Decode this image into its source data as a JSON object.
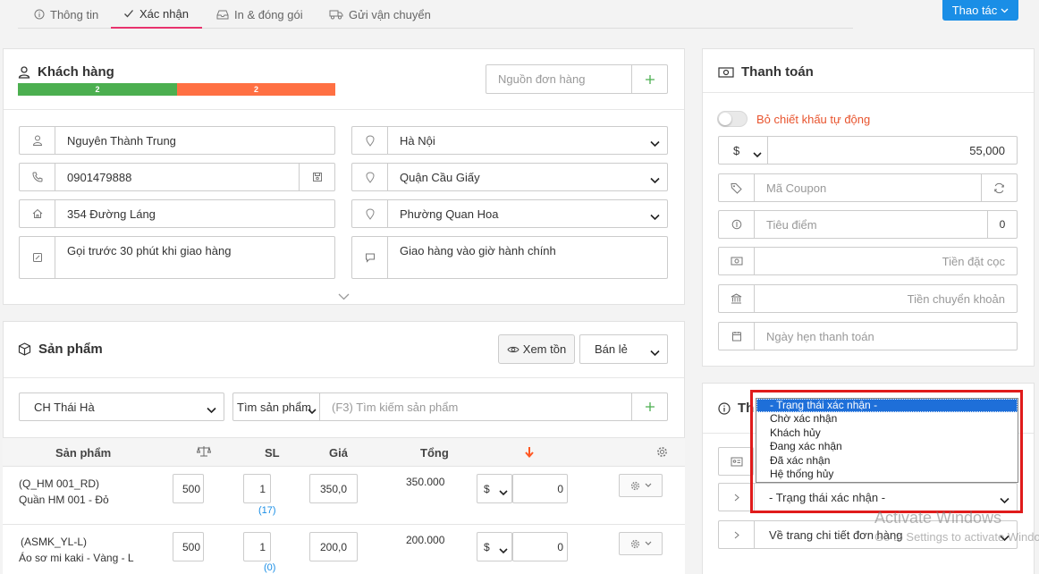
{
  "tabs": [
    {
      "label": "Thông tin",
      "icon": "info-circle-icon"
    },
    {
      "label": "Xác nhận",
      "icon": "check-icon"
    },
    {
      "label": "In & đóng gói",
      "icon": "inbox-icon"
    },
    {
      "label": "Gửi vận chuyển",
      "icon": "truck-icon"
    }
  ],
  "actions_button": "Thao tác",
  "customer": {
    "title": "Khách hàng",
    "progress_green": "2",
    "progress_orange": "2",
    "source_placeholder": "Nguồn đơn hàng",
    "name": "Nguyên Thành Trung",
    "phone": "0901479888",
    "address": "354 Đường Láng",
    "note": "Gọi trước 30 phút khi giao hàng",
    "city": "Hà Nội",
    "district": "Quận Cầu Giấy",
    "ward": "Phường Quan Hoa",
    "delivery_note": "Giao hàng vào giờ hành chính"
  },
  "products": {
    "title": "Sản phẩm",
    "view_stock": "Xem tồn",
    "sale_type": "Bán lẻ",
    "store": "CH Thái Hà",
    "search_type": "Tìm sản phẩm",
    "search_placeholder": "(F3) Tìm kiếm sản phẩm",
    "columns": {
      "product": "Sản phẩm",
      "qty": "SL",
      "price": "Giá",
      "total": "Tổng"
    },
    "rows": [
      {
        "code": "(Q_HM 001_RD)",
        "name": "Quần HM 001 - Đỏ",
        "weight": "500",
        "qty": "1",
        "stock": "(17)",
        "price": "350,0",
        "total": "350.000",
        "currency": "$",
        "discount": "0"
      },
      {
        "code": "(ASMK_YL-L)",
        "name": "Áo sơ mi kaki - Vàng - L",
        "weight": "500",
        "qty": "1",
        "stock": "(0)",
        "price": "200,0",
        "total": "200.000",
        "currency": "$",
        "discount": "0"
      }
    ]
  },
  "payment": {
    "title": "Thanh toán",
    "auto_discount_label": "Bỏ chiết khấu tự động",
    "currency": "$",
    "discount_value": "55,000",
    "coupon_placeholder": "Mã Coupon",
    "points_placeholder": "Tiêu điểm",
    "points_value": "0",
    "deposit_placeholder": "Tiền đặt cọc",
    "transfer_placeholder": "Tiền chuyển khoản",
    "date_placeholder": "Ngày hẹn thanh toán"
  },
  "status_panel": {
    "title_partial": "Th",
    "select_value": "- Trạng thái xác nhận -",
    "after_select_value": "Về trang chi tiết đơn hàng",
    "options": [
      "- Trạng thái xác nhận -",
      "Chờ xác nhận",
      "Khách hủy",
      "Đang xác nhận",
      "Đã xác nhận",
      "Hệ thống hủy"
    ]
  },
  "watermark": {
    "line1": "Activate Windows",
    "line2": "Go to Settings to activate Windows."
  },
  "colors": {
    "accent": "#e8336d",
    "primary": "#1a8ee6",
    "green": "#4caf50",
    "orange": "#ff7043",
    "highlight": "#e01b1b"
  }
}
